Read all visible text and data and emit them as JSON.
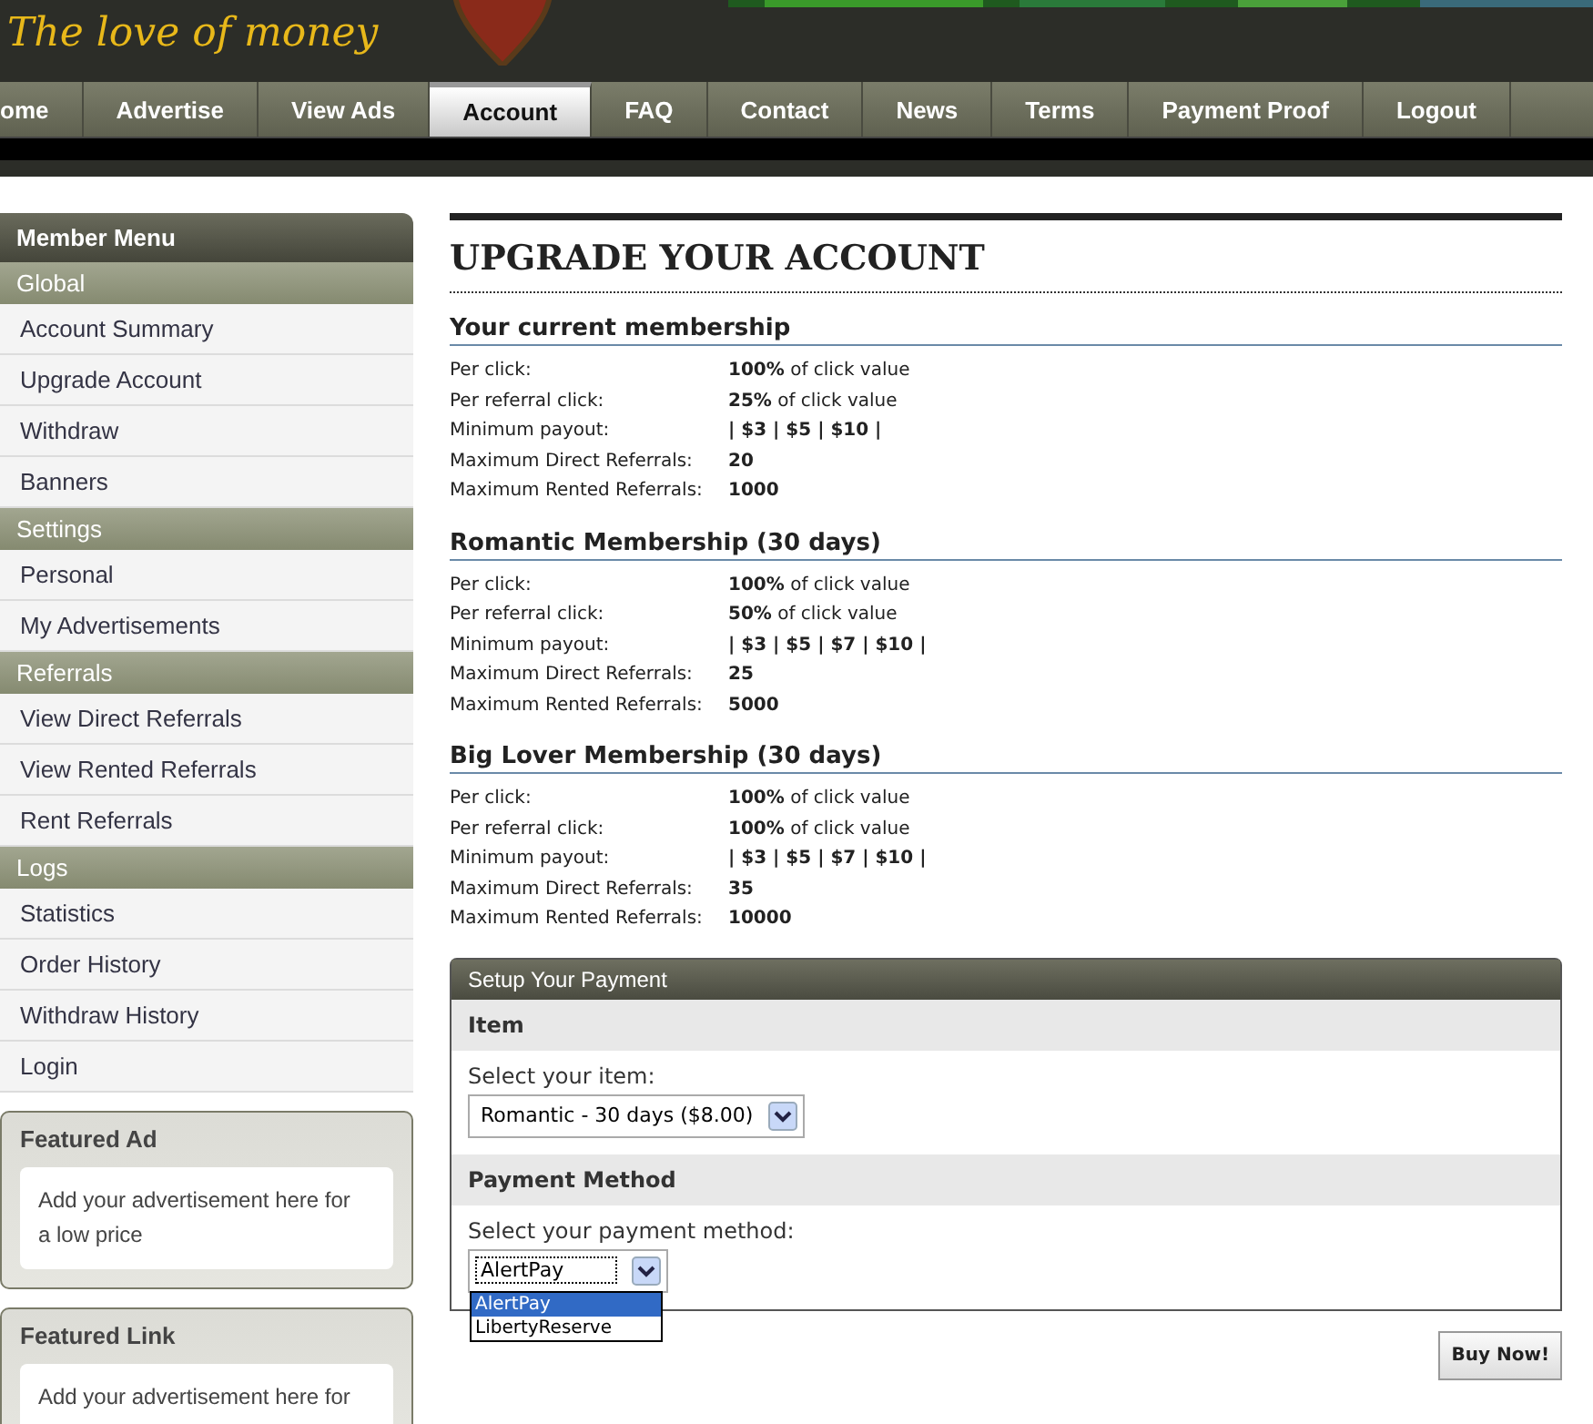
{
  "header": {
    "logo": "The love of money"
  },
  "nav": [
    {
      "label": "ome",
      "selected": false
    },
    {
      "label": "Advertise",
      "selected": false
    },
    {
      "label": "View Ads",
      "selected": false
    },
    {
      "label": "Account",
      "selected": true
    },
    {
      "label": "FAQ",
      "selected": false
    },
    {
      "label": "Contact",
      "selected": false
    },
    {
      "label": "News",
      "selected": false
    },
    {
      "label": "Terms",
      "selected": false
    },
    {
      "label": "Payment Proof",
      "selected": false
    },
    {
      "label": "Logout",
      "selected": false
    }
  ],
  "sidebar": {
    "title": "Member Menu",
    "groups": [
      {
        "label": "Global",
        "items": [
          "Account Summary",
          "Upgrade Account",
          "Withdraw",
          "Banners"
        ]
      },
      {
        "label": "Settings",
        "items": [
          "Personal",
          "My Advertisements"
        ]
      },
      {
        "label": "Referrals",
        "items": [
          "View Direct Referrals",
          "View Rented Referrals",
          "Rent Referrals"
        ]
      },
      {
        "label": "Logs",
        "items": [
          "Statistics",
          "Order History",
          "Withdraw History",
          "Login"
        ]
      }
    ],
    "boxes": [
      {
        "title": "Featured Ad",
        "text": "Add your advertisement here for a low price"
      },
      {
        "title": "Featured Link",
        "text": "Add your advertisement here for"
      }
    ]
  },
  "page_title": "UPGRADE YOUR ACCOUNT",
  "memberships": [
    {
      "title": "Your current membership",
      "rows": [
        {
          "label": "Per click:",
          "value": "**100%** of click value"
        },
        {
          "label": "Per referral click:",
          "value": "**25%** of click value"
        },
        {
          "label": "Minimum payout:",
          "value": "**| $3 | $5 | $10 |**"
        },
        {
          "label": "Maximum Direct Referrals:",
          "value": "**20**"
        },
        {
          "label": "Maximum Rented Referrals:",
          "value": "**1000**"
        }
      ]
    },
    {
      "title": "Romantic Membership (30 days)",
      "rows": [
        {
          "label": "Per click:",
          "value": "**100%** of click value"
        },
        {
          "label": "Per referral click:",
          "value": "**50%** of click value"
        },
        {
          "label": "Minimum payout:",
          "value": "**| $3 | $5 | $7 | $10 |**"
        },
        {
          "label": "Maximum Direct Referrals:",
          "value": "**25**"
        },
        {
          "label": "Maximum Rented Referrals:",
          "value": "**5000**"
        }
      ]
    },
    {
      "title": "Big Lover Membership (30 days)",
      "rows": [
        {
          "label": "Per click:",
          "value": "**100%** of click value"
        },
        {
          "label": "Per referral click:",
          "value": "**100%** of click value"
        },
        {
          "label": "Minimum payout:",
          "value": "**| $3 | $5 | $7 | $10 |**"
        },
        {
          "label": "Maximum Direct Referrals:",
          "value": "**35**"
        },
        {
          "label": "Maximum Rented Referrals:",
          "value": "**10000**"
        }
      ]
    }
  ],
  "payment": {
    "title": "Setup Your Payment",
    "item": {
      "heading": "Item",
      "label": "Select your item:",
      "value": "Romantic - 30 days ($8.00)"
    },
    "method": {
      "heading": "Payment Method",
      "label": "Select your payment method:",
      "value": "AlertPay",
      "options": [
        {
          "label": "AlertPay",
          "selected": true
        },
        {
          "label": "LibertyReserve",
          "selected": false
        }
      ]
    },
    "button": "Buy Now!"
  }
}
